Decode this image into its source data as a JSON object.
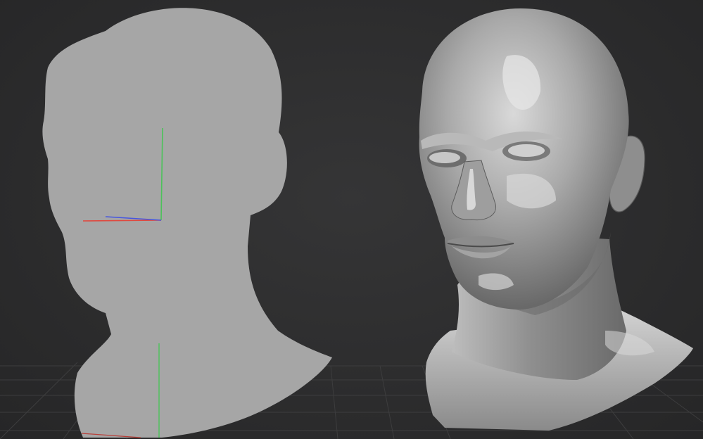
{
  "app": {
    "type": "3d-sculpting-viewport",
    "background_color": "#2e2e2f"
  },
  "viewport": {
    "grid_visible": true,
    "objects": [
      {
        "name": "silhouette-head",
        "shading": "flat",
        "color": "#a6a6a6"
      },
      {
        "name": "sculpted-head",
        "shading": "matcap",
        "color": "#9a9a9a"
      }
    ],
    "gizmo": {
      "axes": [
        "x",
        "y",
        "z"
      ],
      "colors": {
        "x": "#e0483e",
        "y": "#4cc25a",
        "z": "#4656e0"
      }
    }
  }
}
